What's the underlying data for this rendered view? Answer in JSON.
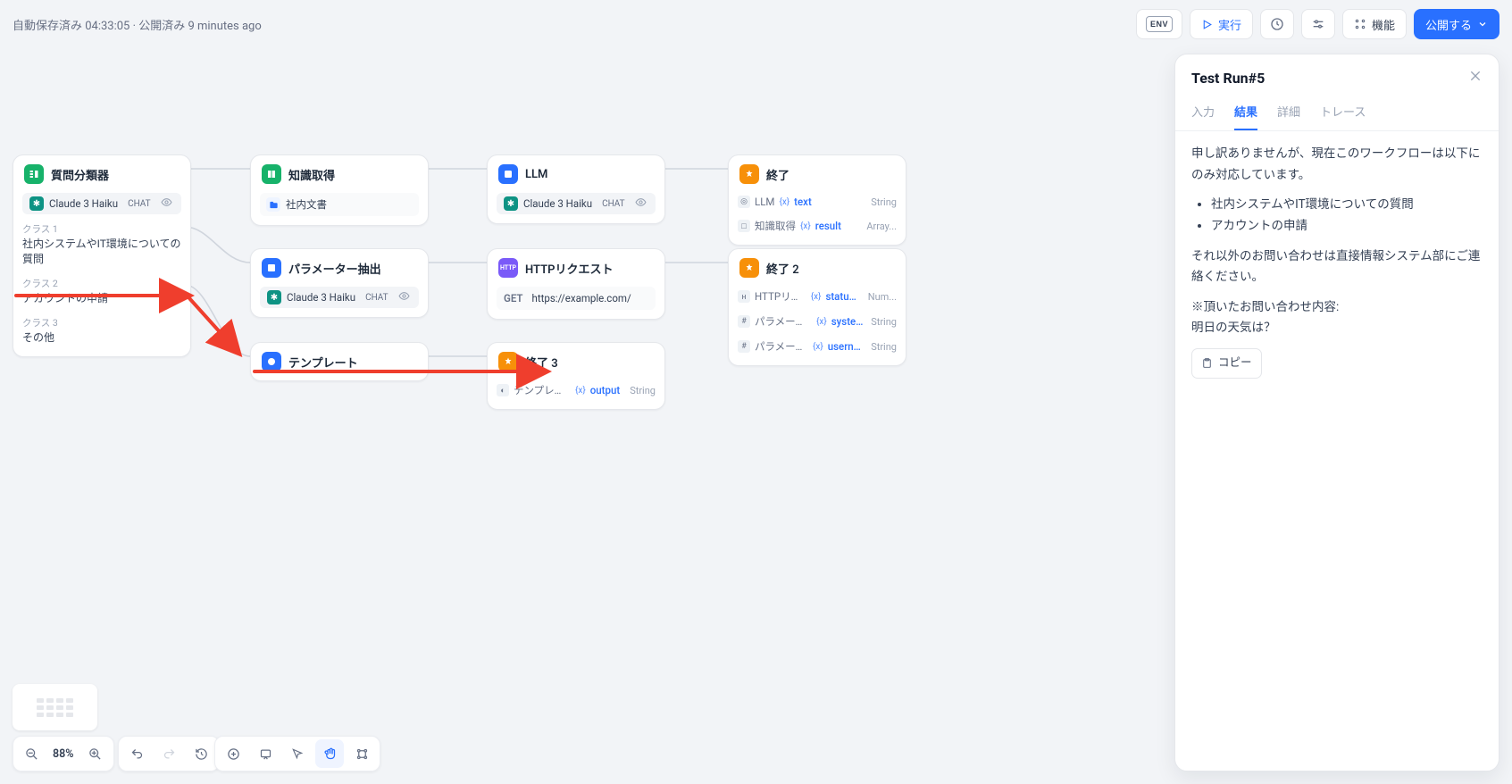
{
  "topbar": {
    "autosave": "自動保存済み 04:33:05",
    "separator": "·",
    "published": "公開済み 9 minutes ago",
    "env_label": "ENV",
    "run_label": "実行",
    "features_label": "機能",
    "publish_label": "公開する"
  },
  "nodes": {
    "classifier": {
      "title": "質問分類器",
      "model": "Claude 3 Haiku",
      "chat_tag": "CHAT",
      "class1_lbl": "クラス 1",
      "class1_txt": "社内システムやIT環境についての質問",
      "class2_lbl": "クラス 2",
      "class2_txt": "アカウントの申請",
      "class3_lbl": "クラス 3",
      "class3_txt": "その他"
    },
    "knowledge": {
      "title": "知識取得",
      "doc": "社内文書"
    },
    "param_extract": {
      "title": "パラメーター抽出",
      "model": "Claude 3 Haiku",
      "chat_tag": "CHAT"
    },
    "template": {
      "title": "テンプレート"
    },
    "llm": {
      "title": "LLM",
      "model": "Claude 3 Haiku",
      "chat_tag": "CHAT"
    },
    "http": {
      "title": "HTTPリクエスト",
      "method": "GET",
      "url": "https://example.com/"
    },
    "end1": {
      "title": "終了",
      "row1_src": "LLM",
      "row1_var": "text",
      "row1_type": "String",
      "row2_src": "知識取得",
      "row2_var": "result",
      "row2_type": "Array..."
    },
    "end2": {
      "title": "終了 2",
      "row1_src": "HTTPリク...",
      "row1_var": "status...",
      "row1_type": "Num...",
      "row2_src": "パラメータ...",
      "row2_var": "syste...",
      "row2_type": "String",
      "row3_src": "パラメータ...",
      "row3_var": "userna...",
      "row3_type": "String"
    },
    "end3": {
      "title": "終了 3",
      "row1_src": "テンプレート",
      "row1_var": "output",
      "row1_type": "String"
    }
  },
  "panel": {
    "title": "Test Run#5",
    "tabs": {
      "input": "入力",
      "result": "結果",
      "detail": "詳細",
      "trace": "トレース"
    },
    "p1": "申し訳ありませんが、現在このワークフローは以下にのみ対応しています。",
    "li1": "社内システムやIT環境についての質問",
    "li2": "アカウントの申請",
    "p2": "それ以外のお問い合わせは直接情報システム部にご連絡ください。",
    "p3a": "※頂いたお問い合わせ内容:",
    "p3b": "明日の天気は？",
    "copy_label": "コピー"
  },
  "bottom": {
    "zoom": "88%"
  }
}
